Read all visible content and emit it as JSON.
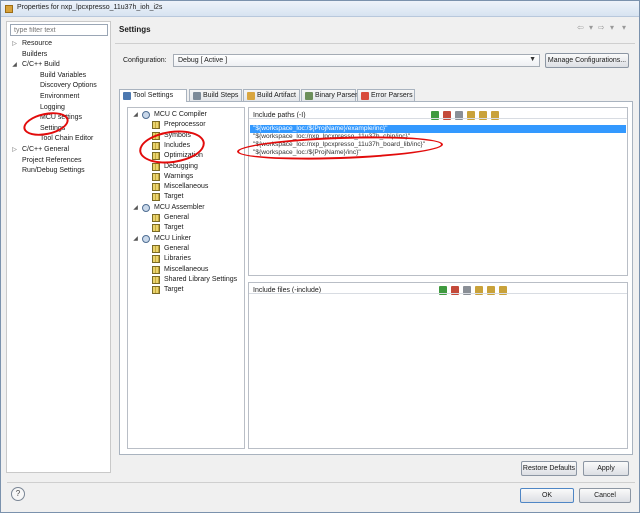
{
  "window": {
    "title": "Properties for nxp_lpcxpresso_11u37h_ioh_i2s"
  },
  "filter": {
    "placeholder": "type filter text"
  },
  "left_tree": [
    {
      "label": "Resource",
      "toggle": "▷"
    },
    {
      "label": "Builders",
      "toggle": ""
    },
    {
      "label": "C/C++ Build",
      "toggle": "◢"
    },
    {
      "label": "Build Variables",
      "toggle": ""
    },
    {
      "label": "Discovery Options",
      "toggle": ""
    },
    {
      "label": "Environment",
      "toggle": ""
    },
    {
      "label": "Logging",
      "toggle": ""
    },
    {
      "label": "MCU settings",
      "toggle": ""
    },
    {
      "label": "Settings",
      "toggle": ""
    },
    {
      "label": "Tool Chain Editor",
      "toggle": ""
    },
    {
      "label": "C/C++ General",
      "toggle": "▷"
    },
    {
      "label": "Project References",
      "toggle": ""
    },
    {
      "label": "Run/Debug Settings",
      "toggle": ""
    }
  ],
  "header": {
    "title": "Settings",
    "nav": "⇦ ▾ ⇨ ▾ ▾"
  },
  "configuration": {
    "label": "Configuration:",
    "value": "Debug  [ Active ]",
    "manage_label": "Manage Configurations..."
  },
  "tabs": [
    {
      "label": "Tool Settings",
      "color": "#4c78b0"
    },
    {
      "label": "Build Steps",
      "color": "#7d8b99"
    },
    {
      "label": "Build Artifact",
      "color": "#d9a640"
    },
    {
      "label": "Binary Parsers",
      "color": "#6d8f5a"
    },
    {
      "label": "Error Parsers",
      "color": "#d84a3a"
    }
  ],
  "tool_tree": [
    {
      "label": "MCU C Compiler",
      "toggle": "◢",
      "kind": "tool"
    },
    {
      "label": "Preprocessor",
      "toggle": "",
      "kind": "cfg"
    },
    {
      "label": "Symbols",
      "toggle": "",
      "kind": "cfg"
    },
    {
      "label": "Includes",
      "toggle": "",
      "kind": "cfg"
    },
    {
      "label": "Optimization",
      "toggle": "",
      "kind": "cfg"
    },
    {
      "label": "Debugging",
      "toggle": "",
      "kind": "cfg"
    },
    {
      "label": "Warnings",
      "toggle": "",
      "kind": "cfg"
    },
    {
      "label": "Miscellaneous",
      "toggle": "",
      "kind": "cfg"
    },
    {
      "label": "Target",
      "toggle": "",
      "kind": "cfg"
    },
    {
      "label": "MCU Assembler",
      "toggle": "◢",
      "kind": "tool"
    },
    {
      "label": "General",
      "toggle": "",
      "kind": "cfg"
    },
    {
      "label": "Target",
      "toggle": "",
      "kind": "cfg"
    },
    {
      "label": "MCU Linker",
      "toggle": "◢",
      "kind": "tool"
    },
    {
      "label": "General",
      "toggle": "",
      "kind": "cfg"
    },
    {
      "label": "Libraries",
      "toggle": "",
      "kind": "cfg"
    },
    {
      "label": "Miscellaneous",
      "toggle": "",
      "kind": "cfg"
    },
    {
      "label": "Shared Library Settings",
      "toggle": "",
      "kind": "cfg"
    },
    {
      "label": "Target",
      "toggle": "",
      "kind": "cfg"
    }
  ],
  "include_paths": {
    "title": "Include paths (-I)",
    "items": [
      "\"${workspace_loc:/${ProjName}/example/inc}\"",
      "\"${workspace_loc:/nxp_lpcxpresso_11u37h_chip/inc}\"",
      "\"${workspace_loc:/nxp_lpcxpresso_11u37h_board_lib/inc}\"",
      "\"${workspace_loc:/${ProjName}/inc}\""
    ]
  },
  "include_files": {
    "title": "Include files (-include)"
  },
  "panel_icons": [
    {
      "name": "add-icon",
      "color": "#3f9a3f"
    },
    {
      "name": "add-workspace-icon",
      "color": "#c44a3a"
    },
    {
      "name": "delete-icon",
      "color": "#8a8f96"
    },
    {
      "name": "edit-icon",
      "color": "#c9a23a"
    },
    {
      "name": "move-up-icon",
      "color": "#c9a23a"
    },
    {
      "name": "move-down-icon",
      "color": "#c9a23a"
    }
  ],
  "buttons": {
    "restore": "Restore Defaults",
    "apply": "Apply",
    "ok": "OK",
    "cancel": "Cancel",
    "help": "?"
  }
}
